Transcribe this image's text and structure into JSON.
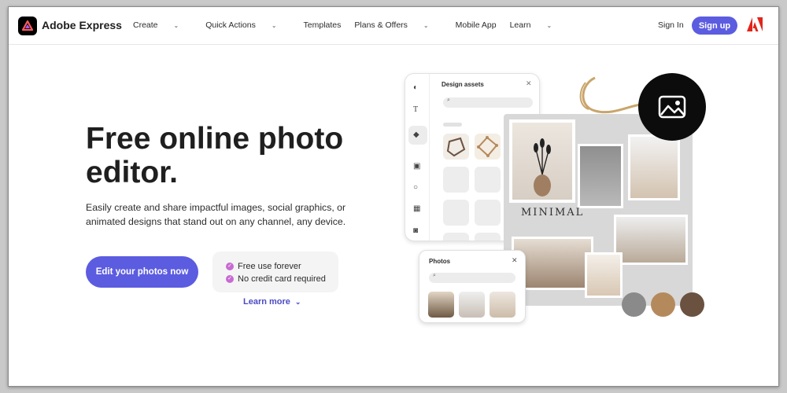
{
  "header": {
    "brand": "Adobe Express",
    "menu": [
      {
        "label": "Create",
        "dropdown": true
      },
      {
        "label": "Quick Actions",
        "dropdown": true
      },
      {
        "label": "Templates",
        "dropdown": false
      },
      {
        "label": "Plans & Offers",
        "dropdown": true
      },
      {
        "label": "Mobile App",
        "dropdown": false
      },
      {
        "label": "Learn",
        "dropdown": true
      }
    ],
    "sign_in": "Sign In",
    "sign_up": "Sign up"
  },
  "hero": {
    "title": "Free online photo editor.",
    "description": "Easily create and share impactful images, social graphics, or animated designs that stand out on any channel, any device.",
    "cta": "Edit your photos now",
    "benefits": [
      "Free use forever",
      "No credit card required"
    ],
    "learn_more": "Learn more"
  },
  "mockup": {
    "assets_panel_title": "Design assets",
    "photos_panel_title": "Photos",
    "board_text": "MINIMAL",
    "swatches": [
      "#8a8a8a",
      "#b48a5d",
      "#6b5140"
    ]
  },
  "colors": {
    "accent": "#5c5ce0",
    "check": "#c86ad2"
  }
}
